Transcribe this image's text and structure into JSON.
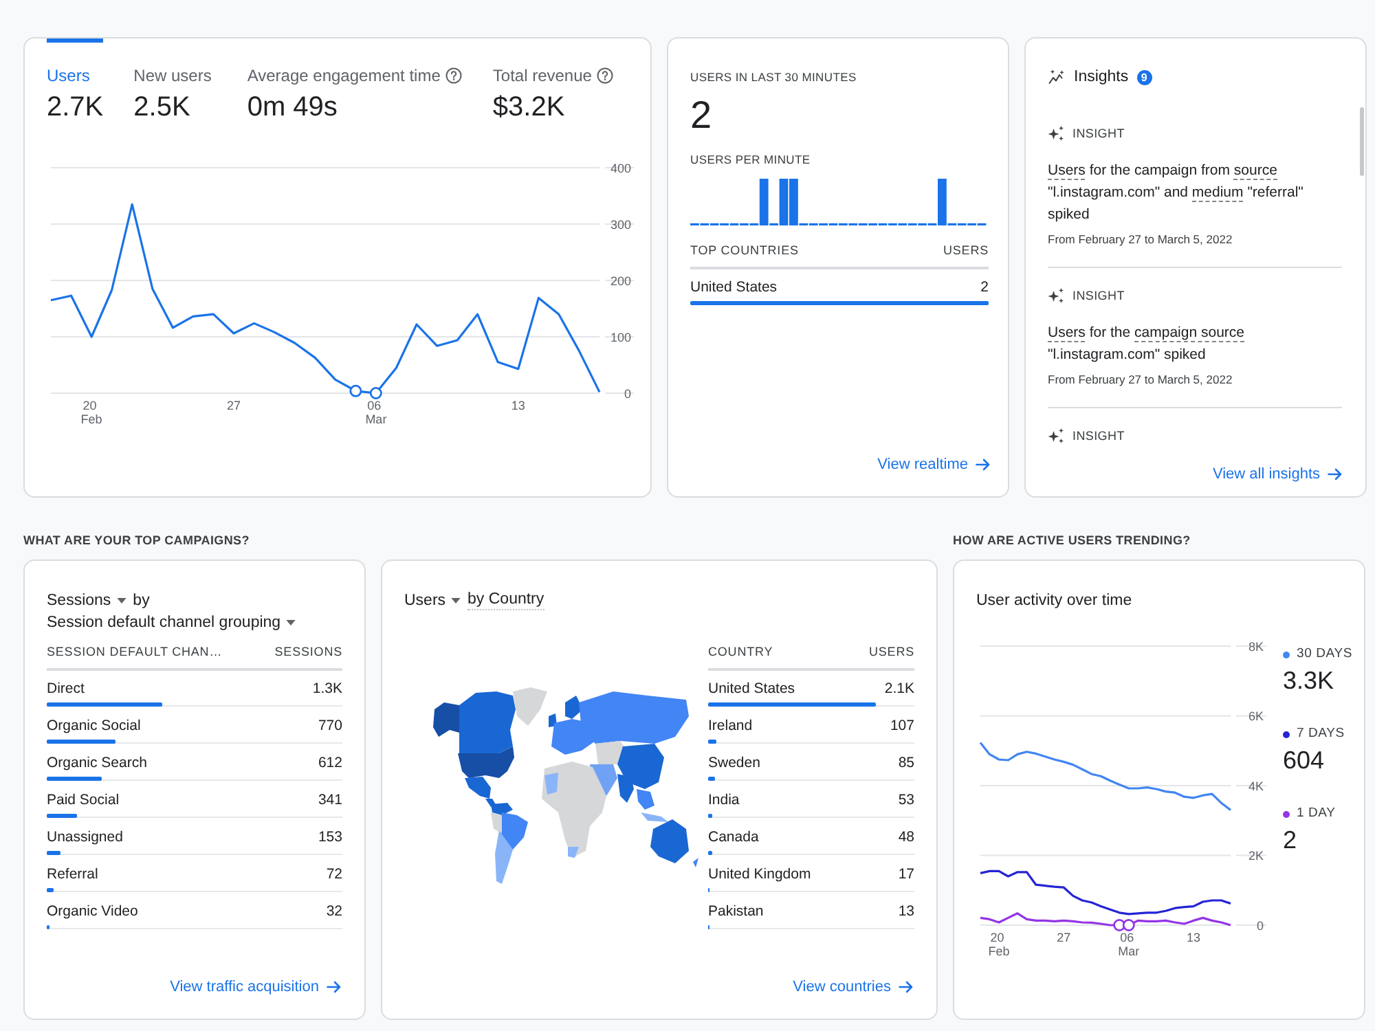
{
  "overview_card": {
    "metric_tabs": [
      {
        "label": "Users",
        "value": "2.7K",
        "selected": true,
        "help": false
      },
      {
        "label": "New users",
        "value": "2.5K",
        "selected": false,
        "help": false
      },
      {
        "label": "Average engagement time",
        "value": "0m 49s",
        "selected": false,
        "help": true
      },
      {
        "label": "Total revenue",
        "value": "$3.2K",
        "selected": false,
        "help": true
      }
    ],
    "chart_data": {
      "type": "line",
      "categories": [
        null,
        null,
        "20 Feb",
        null,
        null,
        null,
        null,
        null,
        null,
        "27",
        null,
        null,
        null,
        null,
        null,
        null,
        "06 Mar",
        null,
        null,
        null,
        null,
        null,
        null,
        "13",
        null,
        null,
        null,
        null
      ],
      "series": [
        {
          "color": "#1a73e8",
          "values": [
            165,
            173,
            100,
            183,
            335,
            185,
            116,
            136,
            140,
            106,
            124,
            108,
            89,
            63,
            24,
            4,
            0,
            45,
            122,
            84,
            94,
            140,
            55,
            43,
            169,
            140,
            75,
            2
          ]
        },
        {
          "type": "scatter",
          "color": "#1a73e8",
          "values": [
            null,
            null,
            null,
            null,
            null,
            null,
            null,
            null,
            null,
            null,
            null,
            null,
            null,
            null,
            null,
            4,
            0,
            null,
            null,
            null,
            null,
            null,
            null,
            null,
            null,
            null,
            null,
            null
          ]
        }
      ],
      "ylim": [
        0,
        400
      ],
      "yticks": [
        0,
        100,
        200,
        300,
        400
      ],
      "grid": true
    }
  },
  "realtime_card": {
    "title": "USERS IN LAST 30 MINUTES",
    "value": "2",
    "subtitle": "USERS PER MINUTE",
    "columns": [
      "TOP COUNTRIES",
      "USERS"
    ],
    "rows": [
      {
        "name": "United States",
        "value": "2",
        "level": 1
      }
    ],
    "link": "View realtime"
  },
  "insights_card": {
    "title": "Insights",
    "badge": "9",
    "items": [
      {
        "label": "INSIGHT",
        "text_parts": [
          {
            "text": "Users",
            "term": true
          },
          {
            "text": " for the campaign from ",
            "term": false
          },
          {
            "text": "source",
            "term": true
          },
          {
            "text": " \"l.instagram.com\" and ",
            "term": false
          },
          {
            "text": "medium",
            "term": true
          },
          {
            "text": " \"referral\" spiked",
            "term": false
          }
        ],
        "date": "From February 27 to March 5, 2022"
      },
      {
        "label": "INSIGHT",
        "text_parts": [
          {
            "text": "Users",
            "term": true
          },
          {
            "text": " for the ",
            "term": false
          },
          {
            "text": "campaign source",
            "term": true
          },
          {
            "text": " \"l.instagram.com\" spiked",
            "term": false
          }
        ],
        "date": "From February 27 to March 5, 2022"
      },
      {
        "label": "INSIGHT"
      }
    ],
    "link": "View all insights"
  },
  "campaigns_section": {
    "heading": "WHAT ARE YOUR TOP CAMPAIGNS?",
    "sessions_card": {
      "metric": "Sessions",
      "connector": "by",
      "dimension": "Session default channel grouping",
      "columns": [
        "SESSION DEFAULT CHAN…",
        "SESSIONS"
      ],
      "rows": [
        {
          "name": "Direct",
          "value": "1.3K",
          "level": 0.39
        },
        {
          "name": "Organic Social",
          "value": "770",
          "level": 0.234
        },
        {
          "name": "Organic Search",
          "value": "612",
          "level": 0.186
        },
        {
          "name": "Paid Social",
          "value": "341",
          "level": 0.104
        },
        {
          "name": "Unassigned",
          "value": "153",
          "level": 0.047
        },
        {
          "name": "Referral",
          "value": "72",
          "level": 0.022
        },
        {
          "name": "Organic Video",
          "value": "32",
          "level": 0.01
        }
      ],
      "link": "View traffic acquisition"
    },
    "country_card": {
      "metric": "Users",
      "dimension": "by Country",
      "columns": [
        "COUNTRY",
        "USERS"
      ],
      "rows": [
        {
          "name": "United States",
          "value": "2.1K",
          "level": 0.81
        },
        {
          "name": "Ireland",
          "value": "107",
          "level": 0.04
        },
        {
          "name": "Sweden",
          "value": "85",
          "level": 0.03
        },
        {
          "name": "India",
          "value": "53",
          "level": 0.02
        },
        {
          "name": "Canada",
          "value": "48",
          "level": 0.018
        },
        {
          "name": "United Kingdom",
          "value": "17",
          "level": 0.008
        },
        {
          "name": "Pakistan",
          "value": "13",
          "level": 0.006
        }
      ],
      "link": "View countries"
    }
  },
  "trending_section": {
    "heading": "HOW ARE ACTIVE USERS TRENDING?",
    "activity_card": {
      "title": "User activity over time",
      "chart_data": {
        "type": "line",
        "categories": [
          null,
          null,
          "20 Feb",
          null,
          null,
          null,
          null,
          null,
          null,
          "27",
          null,
          null,
          null,
          null,
          null,
          null,
          "06 Mar",
          null,
          null,
          null,
          null,
          null,
          null,
          "13",
          null,
          null,
          null,
          null
        ],
        "series": [
          {
            "color": "#4285f4",
            "values": [
              5230,
              4900,
              4750,
              4730,
              4900,
              4970,
              4920,
              4830,
              4750,
              4680,
              4600,
              4470,
              4330,
              4270,
              4140,
              4030,
              3920,
              3920,
              3950,
              3900,
              3830,
              3800,
              3680,
              3650,
              3720,
              3760,
              3500,
              3300
            ]
          },
          {
            "color": "#2424d6",
            "values": [
              1490,
              1550,
              1550,
              1400,
              1520,
              1520,
              1160,
              1130,
              1100,
              1080,
              840,
              710,
              650,
              540,
              450,
              360,
              320,
              340,
              360,
              360,
              410,
              490,
              520,
              540,
              670,
              710,
              710,
              620
            ]
          },
          {
            "color": "#9334e6",
            "values": [
              210,
              170,
              80,
              210,
              340,
              170,
              130,
              130,
              110,
              130,
              110,
              80,
              70,
              40,
              0,
              0,
              0,
              130,
              110,
              110,
              130,
              80,
              40,
              130,
              210,
              130,
              80,
              0
            ]
          },
          {
            "type": "scatter",
            "color": "#9334e6",
            "values": [
              null,
              null,
              null,
              null,
              null,
              null,
              null,
              null,
              null,
              null,
              null,
              null,
              null,
              null,
              null,
              0,
              0,
              null,
              null,
              null,
              null,
              null,
              null,
              null,
              null,
              null,
              null,
              null
            ]
          }
        ],
        "ylim": [
          0,
          8000
        ],
        "yticks": [
          {
            "value": 0,
            "label": "0"
          },
          {
            "value": 2000,
            "label": "2K"
          },
          {
            "value": 4000,
            "label": "4K"
          },
          {
            "value": 6000,
            "label": "6K"
          },
          {
            "value": 8000,
            "label": "8K"
          }
        ],
        "grid": true
      },
      "legend": [
        {
          "label": "30 DAYS",
          "value": "3.3K",
          "color": "#4285f4"
        },
        {
          "label": "7 DAYS",
          "value": "604",
          "color": "#2424d6"
        },
        {
          "label": "1 DAY",
          "value": "2",
          "color": "#9334e6"
        }
      ]
    }
  }
}
